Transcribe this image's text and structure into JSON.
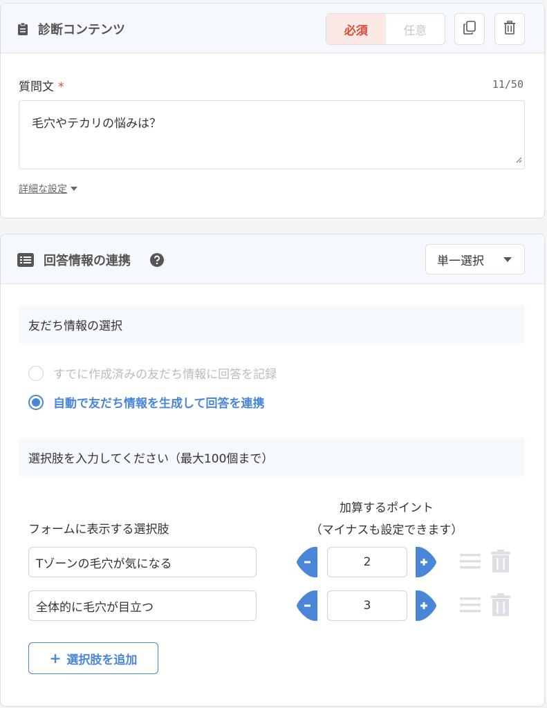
{
  "content_card": {
    "title": "診断コンテンツ",
    "required_label": "必須",
    "optional_label": "任意",
    "question_label": "質問文",
    "required_mark": "*",
    "char_count": "11/50",
    "question_value": "毛穴やテカリの悩みは？",
    "detail_settings_label": "詳細な設定"
  },
  "answer_card": {
    "title": "回答情報の連携",
    "select_value": "単一選択",
    "friend_info_section": "友だち情報の選択",
    "radio_options": [
      {
        "label": "すでに作成済みの友だち情報に回答を記録",
        "checked": false
      },
      {
        "label": "自動で友だち情報を生成して回答を連携",
        "checked": true
      }
    ],
    "choices_section": "選択肢を入力してください（最大100個まで）",
    "column_choice": "フォームに表示する選択肢",
    "column_points_line1": "加算するポイント",
    "column_points_line2": "（マイナスも設定できます）",
    "choices": [
      {
        "text": "Tゾーンの毛穴が気になる",
        "points": "2"
      },
      {
        "text": "全体的に毛穴が目立つ",
        "points": "3"
      }
    ],
    "add_choice_label": "選択肢を追加",
    "add_choice_icon": "+"
  },
  "colors": {
    "accent": "#4a86d8",
    "required": "#e0483a",
    "header_bg": "#f5f8fd"
  }
}
